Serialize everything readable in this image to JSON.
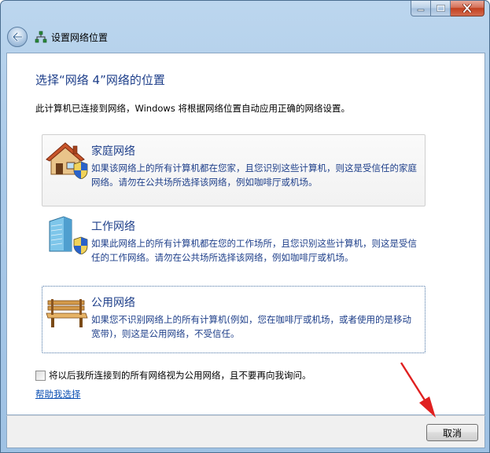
{
  "window": {
    "nav_title": "设置网络位置"
  },
  "page": {
    "heading": "选择“网络 4”网络的位置",
    "intro": "此计算机已连接到网络，Windows 将根据网络位置自动应用正确的网络设置。"
  },
  "options": [
    {
      "title": "家庭网络",
      "description": "如果该网络上的所有计算机都在您家，且您识别这些计算机，则这是受信任的家庭网络。请勿在公共场所选择该网络，例如咖啡厅或机场。",
      "icon": "home-network-icon"
    },
    {
      "title": "工作网络",
      "description": "如果此网络上的所有计算机都在您的工作场所，且您识别这些计算机，则这是受信任的工作网络。请勿在公共场所选择该网络，例如咖啡厅或机场。",
      "icon": "work-network-icon"
    },
    {
      "title": "公用网络",
      "description": "如果您不识别网络上的所有计算机(例如，您在咖啡厅或机场，或者使用的是移动宽带)，则这是公用网络，不受信任。",
      "icon": "public-network-icon"
    }
  ],
  "checkbox": {
    "label": "将以后我所连接到的所有网络视为公用网络，且不要再向我询问。",
    "checked": false
  },
  "help_link": "帮助我选择",
  "footer": {
    "cancel_label": "取消"
  },
  "colors": {
    "heading": "#1e3f8a",
    "link": "#0b4fb3",
    "annotation_arrow": "#e02020"
  }
}
